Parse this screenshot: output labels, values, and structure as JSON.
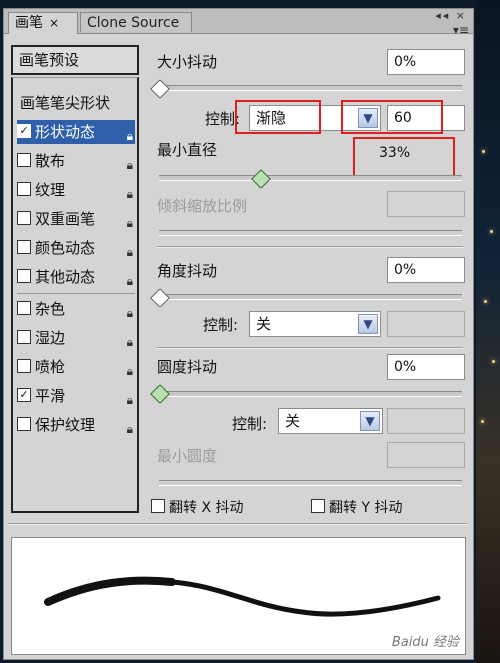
{
  "tabs": [
    {
      "label": "画笔",
      "active": true,
      "close": "×"
    },
    {
      "label": "Clone Source",
      "active": false
    }
  ],
  "panel_icons": "◂◂ ×",
  "menu_icon": "▾≡",
  "left": {
    "preset_button": "画笔预设",
    "tip_shape": "画笔笔尖形状",
    "items": [
      {
        "label": "形状动态",
        "checked": true,
        "selected": true
      },
      {
        "label": "散布",
        "checked": false
      },
      {
        "label": "纹理",
        "checked": false
      },
      {
        "label": "双重画笔",
        "checked": false
      },
      {
        "label": "颜色动态",
        "checked": false
      },
      {
        "label": "其他动态",
        "checked": false
      },
      {
        "label": "杂色",
        "checked": false
      },
      {
        "label": "湿边",
        "checked": false
      },
      {
        "label": "喷枪",
        "checked": false
      },
      {
        "label": "平滑",
        "checked": true
      },
      {
        "label": "保护纹理",
        "checked": false
      }
    ]
  },
  "size_jitter": {
    "label": "大小抖动",
    "value": "0%",
    "slider_value": 0
  },
  "control1": {
    "label": "控制:",
    "value": "渐隐",
    "steps": "60"
  },
  "min_diameter": {
    "label": "最小直径",
    "value": "33%",
    "slider_value": 33
  },
  "tilt_scale": {
    "label": "倾斜缩放比例",
    "value": ""
  },
  "angle_jitter": {
    "label": "角度抖动",
    "value": "0%",
    "slider_value": 0
  },
  "control2": {
    "label": "控制:",
    "value": "关"
  },
  "roundness_jitter": {
    "label": "圆度抖动",
    "value": "0%",
    "slider_value": 0
  },
  "control3": {
    "label": "控制:",
    "value": "关"
  },
  "min_roundness": {
    "label": "最小圆度",
    "value": ""
  },
  "flip_x": {
    "label": "翻转 X 抖动",
    "checked": false
  },
  "flip_y": {
    "label": "翻转 Y 抖动",
    "checked": false
  },
  "watermark": "Baidu 经验",
  "colors": {
    "selection": "#2f5fa8",
    "annotation": "#e02020"
  }
}
